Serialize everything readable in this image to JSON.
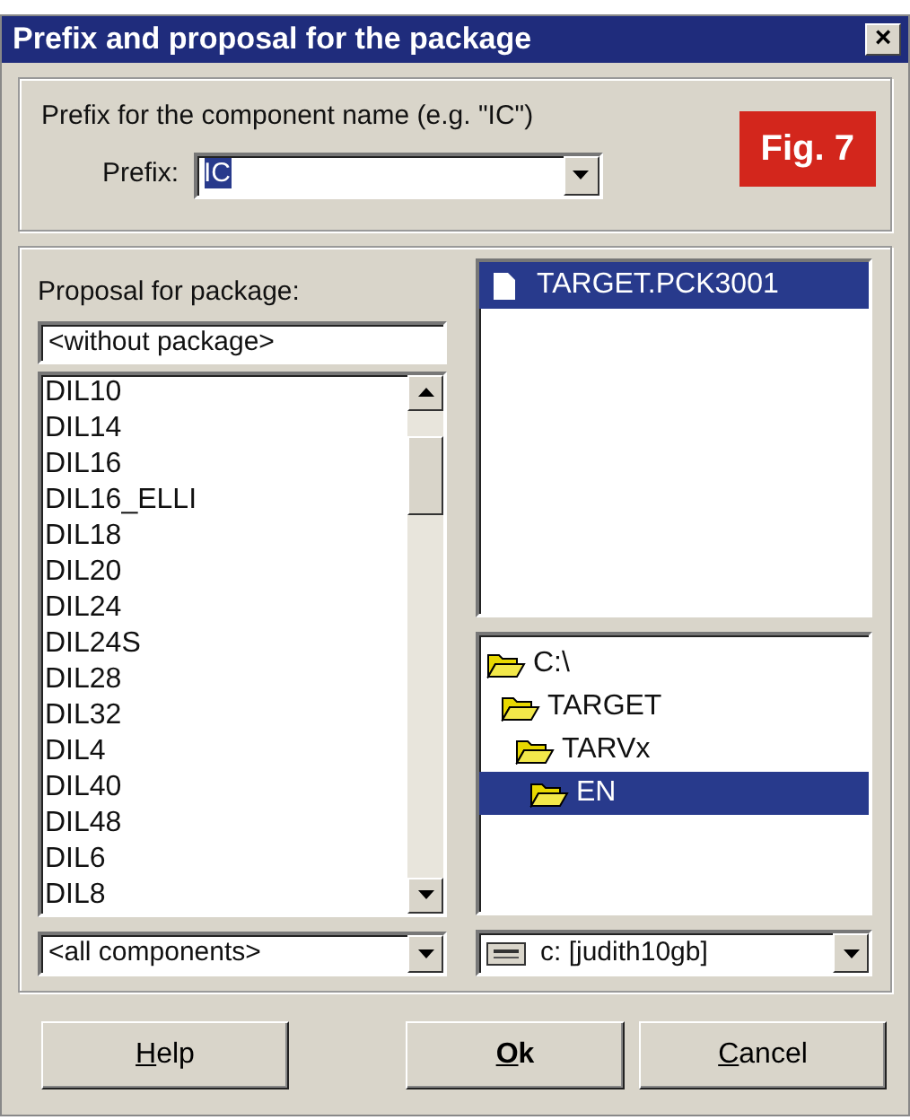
{
  "window": {
    "title": "Prefix and proposal for the package",
    "close": "×"
  },
  "prefix_group": {
    "hint": "Prefix for the component name (e.g. \"IC\")",
    "label": "Prefix:",
    "value": "IC",
    "value_selected": true,
    "badge": "Fig. 7"
  },
  "package": {
    "label": "Proposal for package:",
    "field": "<without package>",
    "items": [
      {
        "text": "DIL10",
        "selected": false
      },
      {
        "text": "DIL14",
        "selected": false
      },
      {
        "text": "DIL16",
        "selected": false
      },
      {
        "text": "DIL16_ELLI",
        "selected": false
      },
      {
        "text": "DIL18",
        "selected": false
      },
      {
        "text": "DIL20",
        "selected": false
      },
      {
        "text": "DIL24",
        "selected": false
      },
      {
        "text": "DIL24S",
        "selected": false
      },
      {
        "text": "DIL28",
        "selected": false
      },
      {
        "text": "DIL32",
        "selected": false
      },
      {
        "text": "DIL4",
        "selected": false
      },
      {
        "text": "DIL40",
        "selected": false
      },
      {
        "text": "DIL48",
        "selected": false
      },
      {
        "text": "DIL6",
        "selected": false
      },
      {
        "text": "DIL8",
        "selected": false
      }
    ],
    "filter": "<all components>"
  },
  "files": [
    {
      "name": "TARGET.PCK3001",
      "selected": true
    }
  ],
  "folders": [
    {
      "name": "C:\\",
      "selected": false,
      "children": [
        {
          "name": "TARGET",
          "selected": false,
          "children": [
            {
              "name": "TARVx",
              "selected": false,
              "children": [
                {
                  "name": "EN",
                  "selected": true
                }
              ]
            }
          ]
        }
      ]
    }
  ],
  "drive": "c: [judith10gb]",
  "buttons": [
    {
      "label": "Help",
      "default": false
    },
    {
      "label": "Ok",
      "default": true
    },
    {
      "label": "Cancel",
      "default": false
    }
  ]
}
